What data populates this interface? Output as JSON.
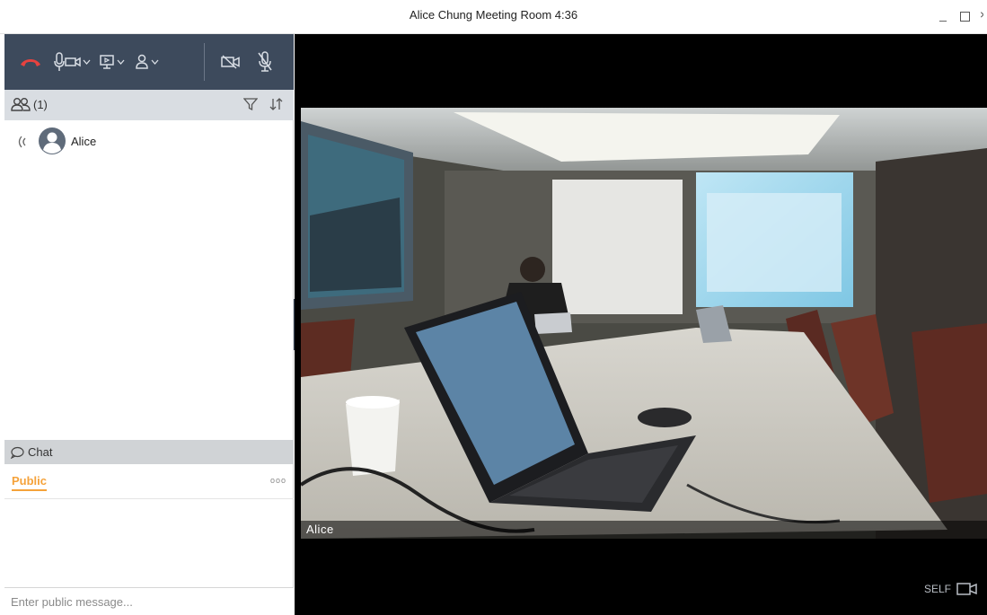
{
  "window": {
    "title": "Alice Chung Meeting Room 4:36"
  },
  "toolbar": {
    "icons": [
      "hangup-icon",
      "microphone-icon",
      "camera-icon",
      "share-screen-icon",
      "user-icon",
      "video-off-icon",
      "mic-off-icon"
    ],
    "hangup_color": "#e8423f"
  },
  "participants": {
    "count_label": "(1)",
    "list": [
      {
        "name": "Alice"
      }
    ]
  },
  "chat": {
    "header": "Chat",
    "tab_public": "Public",
    "more": "ooo",
    "input_placeholder": "Enter public message..."
  },
  "video": {
    "feed_name": "Alice",
    "self_label": "SELF"
  },
  "colors": {
    "toolbar_bg": "#3d4a5c",
    "accent": "#f5a23a"
  }
}
